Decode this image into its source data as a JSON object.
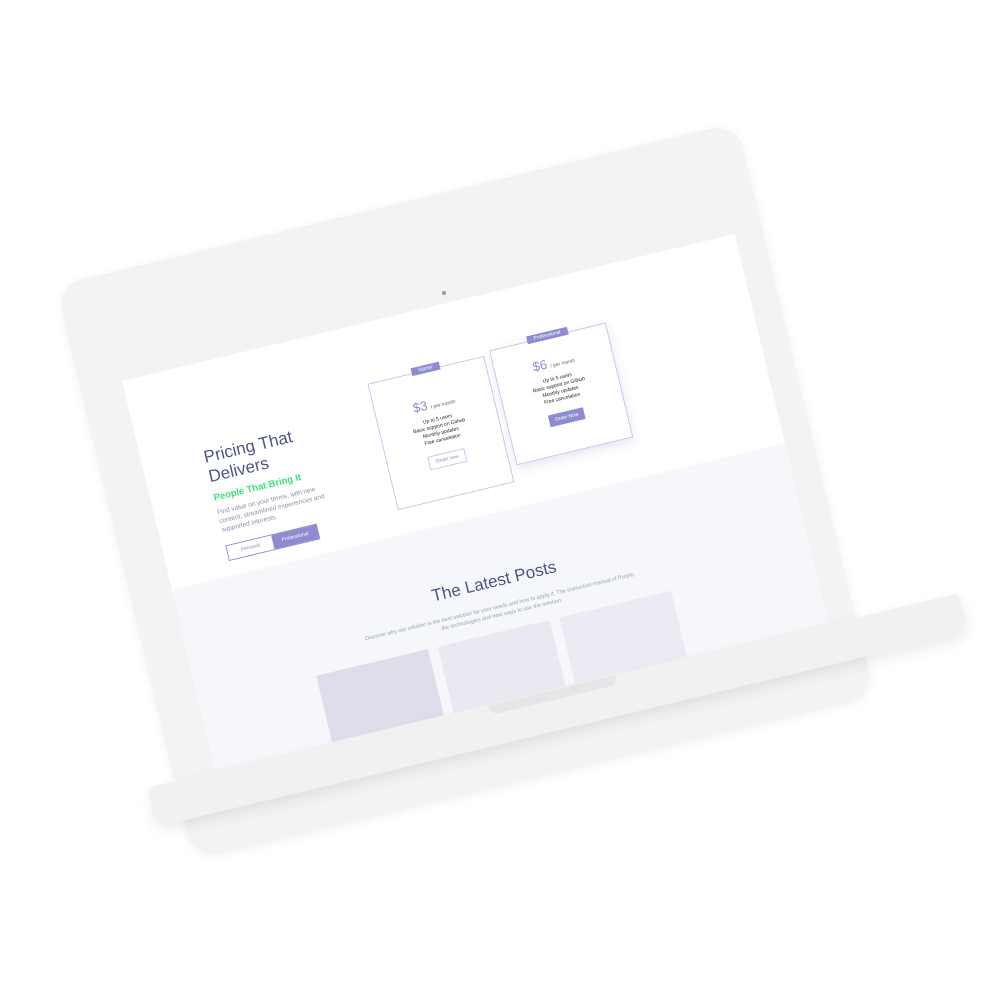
{
  "hero": {
    "title": "Pricing That Delivers",
    "subtitle": "People That Bring It",
    "description": "Find value on your terms, with new content, streamlined experiences and supported interests.",
    "toggle": {
      "personal": "Personal",
      "professional": "Professional"
    }
  },
  "pricing": {
    "starter": {
      "badge": "Starter",
      "price": "$3",
      "period": "/ per month",
      "features": [
        "Up to 5 users",
        "Basic support on Github",
        "Monthly updates",
        "Free cancelation"
      ],
      "button": "Order now"
    },
    "professional": {
      "badge": "Professional",
      "price": "$6",
      "period": "/ per month",
      "features": [
        "Up to 5 users",
        "Basic support on Github",
        "Monthly updates",
        "Free cancelation"
      ],
      "button": "Order Now"
    }
  },
  "posts": {
    "title": "The Latest Posts",
    "description": "Discover why our solution is the best solution for your needs and how to apply it. The instruction manual of Purple, the technologies and new ways to use the solution."
  },
  "colors": {
    "accent": "#8e8bd0",
    "green": "#3fe07c",
    "heading": "#4e5486"
  }
}
